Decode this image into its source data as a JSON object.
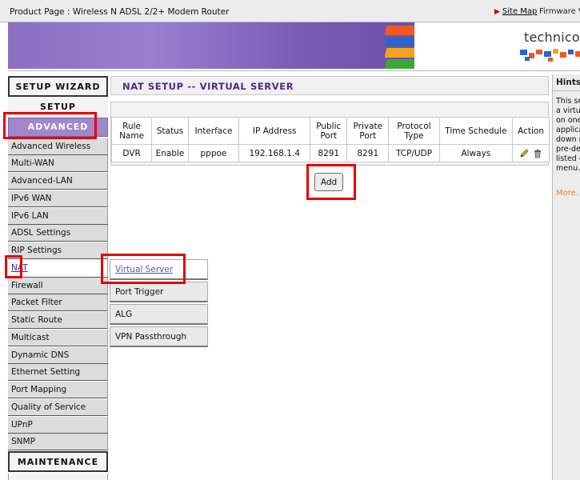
{
  "header": {
    "product": "Product Page : Wireless N ADSL 2/2+ Modem Router",
    "sitemap": "Site Map",
    "firmware": "Firmware V",
    "brand": "technico"
  },
  "nav": {
    "setup_wizard": "SETUP WIZARD",
    "setup": "SETUP",
    "advanced": "ADVANCED",
    "items": [
      "Advanced Wireless",
      "Multi-WAN",
      "Advanced-LAN",
      "IPv6 WAN",
      "IPv6 LAN",
      "ADSL Settings",
      "RIP Settings",
      "NAT",
      "Firewall",
      "Packet Filter",
      "Static Route",
      "Multicast",
      "Dynamic DNS",
      "Ethernet Setting",
      "Port Mapping",
      "Quality of Service",
      "UPnP",
      "SNMP"
    ],
    "maintenance": "MAINTENANCE"
  },
  "main": {
    "title": "NAT SETUP -- VIRTUAL SERVER",
    "columns": [
      "Rule Name",
      "Status",
      "Interface",
      "IP Address",
      "Public Port",
      "Private Port",
      "Protocol Type",
      "Time Schedule",
      "Action"
    ],
    "rows": [
      {
        "rule_name": "DVR",
        "status": "Enable",
        "interface": "pppoe",
        "ip": "192.168.1.4",
        "public_port": "8291",
        "private_port": "8291",
        "protocol": "TCP/UDP",
        "schedule": "Always"
      }
    ],
    "add_label": "Add"
  },
  "submenu": {
    "items": [
      "Virtual Server",
      "Port Trigger",
      "ALG",
      "VPN Passthrough"
    ]
  },
  "hints": {
    "title": "Hints:",
    "lines": [
      "This se",
      "a virtu",
      "on one",
      "applica",
      "down r",
      "pre-de",
      "listed o",
      "menu."
    ],
    "more": "More."
  },
  "colors": {
    "accent_purple": "#9f87c9",
    "title_purple": "#4a2a8a",
    "highlight_red": "#e60000",
    "more_orange": "#e08a2a"
  }
}
